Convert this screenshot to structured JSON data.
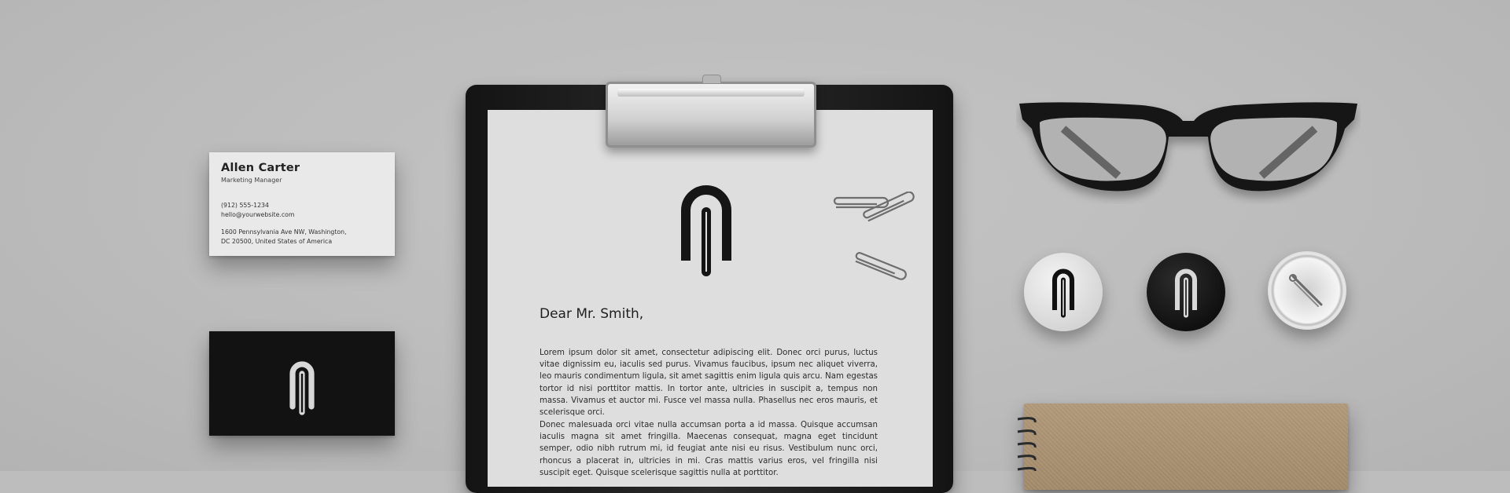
{
  "business_card": {
    "name": "Allen Carter",
    "title": "Marketing Manager",
    "phone": "(912) 555-1234",
    "email": "hello@yourwebsite.com",
    "address_line1": "1600 Pennsylvania Ave NW, Washington,",
    "address_line2": "DC 20500, United States of America"
  },
  "letter": {
    "salutation": "Dear Mr. Smith,",
    "paragraph1": "Lorem ipsum dolor sit amet, consectetur adipiscing elit. Donec orci purus, luctus vitae dignissim eu, iaculis sed purus. Vivamus faucibus, ipsum nec aliquet viverra, leo mauris condimentum ligula, sit amet sagittis enim ligula quis arcu. Nam egestas tortor id nisi porttitor mattis. In tortor ante, ultricies in suscipit a, tempus non massa. Vivamus et auctor mi. Fusce vel massa nulla. Phasellus nec eros mauris, et scelerisque orci.",
    "paragraph2": "Donec malesuada orci vitae nulla accumsan porta a id massa. Quisque accumsan iaculis magna sit amet fringilla. Maecenas consequat, magna eget tincidunt semper, odio nibh rutrum mi, id feugiat ante nisi eu risus. Vestibulum nunc orci, rhoncus a placerat in, ultricies in mi. Cras mattis varius eros, vel fringilla nisi suscipit eget. Quisque scelerisque sagittis nulla at porttitor."
  },
  "icons": {
    "brand_logo": "paperclip-logo-icon",
    "paperclip": "paperclip-icon",
    "glasses": "glasses-icon",
    "badge_pin": "safety-pin-icon",
    "spiral": "spiral-binding-icon"
  },
  "colors": {
    "background": "#bdbdbd",
    "brand_black": "#121212",
    "paper": "#dedede",
    "card_white": "#e9e9e9",
    "kraft": "#a48c6c"
  }
}
